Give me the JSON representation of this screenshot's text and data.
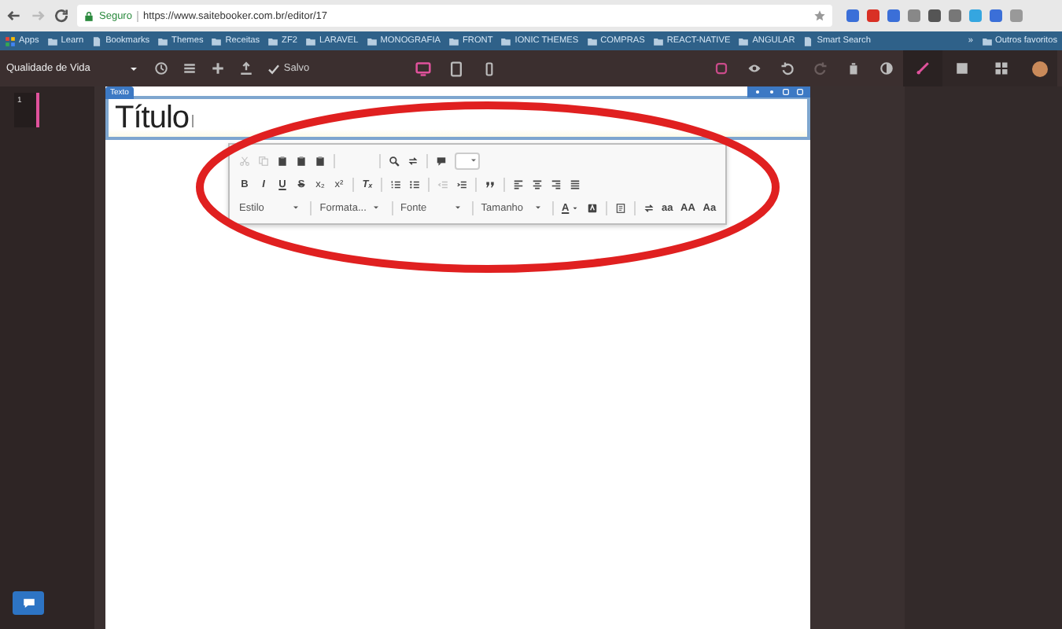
{
  "browser": {
    "nav": [
      {
        "kind": "back",
        "disabled": false
      },
      {
        "kind": "forward",
        "disabled": true
      },
      {
        "kind": "reload",
        "disabled": false
      }
    ],
    "secure_label": "Seguro",
    "url": "https://www.saitebooker.com.br/editor/17",
    "bookmarks": [
      {
        "label": "Apps",
        "kind": "apps"
      },
      {
        "label": "Learn",
        "kind": "folder"
      },
      {
        "label": "Bookmarks",
        "kind": "page"
      },
      {
        "label": "Themes",
        "kind": "folder"
      },
      {
        "label": "Receitas",
        "kind": "folder"
      },
      {
        "label": "ZF2",
        "kind": "folder"
      },
      {
        "label": "LARAVEL",
        "kind": "folder"
      },
      {
        "label": "MONOGRAFIA",
        "kind": "folder"
      },
      {
        "label": "FRONT",
        "kind": "folder"
      },
      {
        "label": "IONIC THEMES",
        "kind": "folder"
      },
      {
        "label": "COMPRAS",
        "kind": "folder"
      },
      {
        "label": "REACT-NATIVE",
        "kind": "folder"
      },
      {
        "label": "ANGULAR",
        "kind": "folder"
      },
      {
        "label": "Smart Search",
        "kind": "page"
      }
    ],
    "overflow": "»",
    "other_bookmarks": "Outros favoritos"
  },
  "editor_bar": {
    "project": "Qualidade de Vida",
    "save_status": "Salvo",
    "devices": [
      {
        "kind": "desktop",
        "selected": true
      },
      {
        "kind": "tablet",
        "selected": false
      },
      {
        "kind": "phone",
        "selected": false
      }
    ],
    "actions": [
      {
        "kind": "square",
        "disabled": false
      },
      {
        "kind": "eye",
        "disabled": false
      },
      {
        "kind": "undo",
        "disabled": false
      },
      {
        "kind": "redo",
        "disabled": true
      },
      {
        "kind": "trash",
        "disabled": false
      },
      {
        "kind": "contrast",
        "disabled": false
      }
    ],
    "panels": [
      {
        "kind": "brush",
        "selected": true
      },
      {
        "kind": "list",
        "selected": false
      },
      {
        "kind": "grid",
        "selected": false
      }
    ]
  },
  "pages": [
    {
      "number": "1",
      "selected": true
    }
  ],
  "text_block": {
    "label": "Texto",
    "content": "Título"
  },
  "rich_toolbar": {
    "edit_tools": [
      {
        "kind": "cut",
        "disabled": true
      },
      {
        "kind": "copy",
        "disabled": true
      },
      {
        "kind": "paste",
        "disabled": false
      },
      {
        "kind": "paste",
        "disabled": false
      },
      {
        "kind": "paste",
        "disabled": false
      },
      {
        "kind": "sep"
      },
      {
        "kind": "gap"
      },
      {
        "kind": "sep"
      },
      {
        "kind": "find",
        "disabled": false
      },
      {
        "kind": "replace",
        "disabled": false
      },
      {
        "kind": "sep"
      },
      {
        "kind": "block",
        "disabled": false
      },
      {
        "kind": "select"
      }
    ],
    "format_tools": [
      {
        "kind": "bold",
        "text": "B"
      },
      {
        "kind": "italic",
        "text": "I"
      },
      {
        "kind": "underline",
        "text": "U"
      },
      {
        "kind": "strike",
        "text": "S"
      },
      {
        "kind": "subscript",
        "text": "x₂"
      },
      {
        "kind": "superscript",
        "text": "x²"
      },
      {
        "kind": "sep"
      },
      {
        "kind": "clear-format",
        "text": "Tₓ"
      },
      {
        "kind": "sep"
      },
      {
        "kind": "numbered-list",
        "disabled": false
      },
      {
        "kind": "bullet-list",
        "disabled": false
      },
      {
        "kind": "sep"
      },
      {
        "kind": "outdent",
        "disabled": true
      },
      {
        "kind": "indent",
        "disabled": false
      },
      {
        "kind": "sep"
      },
      {
        "kind": "quote",
        "disabled": false
      },
      {
        "kind": "sep"
      },
      {
        "kind": "align-left",
        "disabled": false
      },
      {
        "kind": "align-center",
        "disabled": false
      },
      {
        "kind": "align-right",
        "disabled": false
      },
      {
        "kind": "align-justify",
        "disabled": false
      }
    ],
    "style_tools": [
      {
        "kind": "dropdown",
        "text": "Estilo"
      },
      {
        "kind": "sep"
      },
      {
        "kind": "dropdown",
        "text": "Formata..."
      },
      {
        "kind": "sep"
      },
      {
        "kind": "dropdown",
        "text": "Fonte"
      },
      {
        "kind": "sep"
      },
      {
        "kind": "dropdown",
        "text": "Tamanho"
      },
      {
        "kind": "sep"
      },
      {
        "kind": "color",
        "text": "A"
      },
      {
        "kind": "bg-color",
        "disabled": false
      },
      {
        "kind": "sep"
      },
      {
        "kind": "source",
        "disabled": false
      },
      {
        "kind": "sep"
      },
      {
        "kind": "replace",
        "disabled": false
      },
      {
        "kind": "lowercase",
        "text": "aa"
      },
      {
        "kind": "uppercase",
        "text": "AA"
      },
      {
        "kind": "capitalize",
        "text": "Aa"
      }
    ]
  }
}
